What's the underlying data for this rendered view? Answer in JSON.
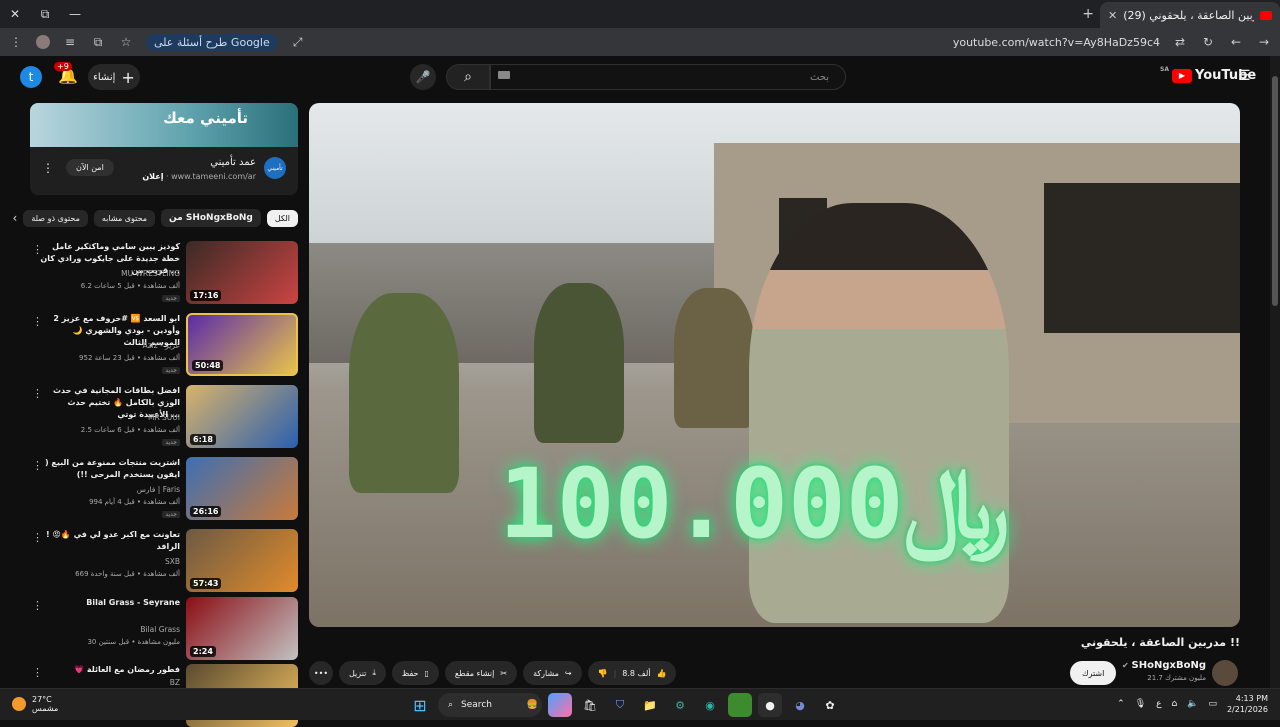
{
  "browser": {
    "tab_title": "(29) مدربين الصاعقة ، يلحقوني !!",
    "tab_close": "✕",
    "new_tab": "+",
    "window_controls": {
      "minimize": "—",
      "restore": "⧉",
      "close": "✕"
    },
    "google_chip": "طرح أسئلة على Google",
    "url": "youtube.com/watch?v=Ay8HaDz59c4"
  },
  "youtube": {
    "avatar_letter": "t",
    "notifications_count": "+9",
    "create_label": "إنشاء",
    "search_placeholder": "بحث",
    "logo_text": "YouTube",
    "logo_region": "SA"
  },
  "ad": {
    "banner_text": "تأميني معك",
    "logo_text": "تأميني",
    "title": "عمد تأميني",
    "sponsor_label": "إعلان",
    "domain": "www.tameeni.com/ar",
    "cta": "امن الآن"
  },
  "chips": [
    {
      "label": "الكل",
      "active": true
    },
    {
      "label": "من SHoNgxBoNg",
      "active": false
    },
    {
      "label": "محتوى مشابه",
      "active": false
    },
    {
      "label": "محتوى ذو صلة",
      "active": false
    }
  ],
  "recommendations": [
    {
      "title": "كوديز يبين سامي وماكثكير عامل خطة جديدة على جايكوب ورادي كان قريب من ...",
      "channel": "MU WRESTLING",
      "meta": "6.2 ألف مشاهدة • قبل 5 ساعات",
      "badge": "جديد",
      "duration": "17:16",
      "colors": [
        "#3a2a24",
        "#c44"
      ]
    },
    {
      "title": "حروف مع عزيز 2# 🆚 ابو السعد وأودين - بودي والشهري 🌙 الموسم الثالث",
      "channel": "Aziz - عزيز",
      "meta": "952 ألف مشاهدة • قبل 23 ساعة",
      "badge": "جديد",
      "duration": "50:48",
      "colors": [
        "#5b2aa8",
        "#e8c44b"
      ]
    },
    {
      "title": "افضل بطاقات المجانية في حدث الوزي بالكامل 🔥 تختيم حدث الأعمدة توتي ...",
      "channel": "MR SUUI",
      "meta": "2.5 ألف مشاهدة • قبل 6 ساعات",
      "badge": "جديد",
      "duration": "6:18",
      "colors": [
        "#d9b36b",
        "#2a5fb0"
      ]
    },
    {
      "title": "اشتريت منتجات ممنوعة من البيع ( ايفون يستخدم المرحى !!)",
      "channel": "فارس | Faris",
      "meta": "994 ألف مشاهدة • قبل 4 أيام",
      "badge": "جديد",
      "duration": "26:16",
      "colors": [
        "#3d6fb4",
        "#c97a3a"
      ]
    },
    {
      "title": "! 😡🔥 تعاونت مع اكبر عدو لي في الرافد",
      "channel": "SXB",
      "meta": "669 ألف مشاهدة • قبل سنة واحدة",
      "badge": "",
      "duration": "57:43",
      "colors": [
        "#6b5a44",
        "#e28b2b"
      ]
    },
    {
      "title": "Bilal Grass - Seyrane",
      "channel": "Bilal Grass",
      "meta": "30 مليون مشاهدة • قبل سنتين",
      "badge": "",
      "duration": "2:24",
      "colors": [
        "#8b0d14",
        "#c2c2c2"
      ]
    },
    {
      "title": "💗 فطور رمضان مع العائلة",
      "channel": "BZ",
      "meta": "",
      "badge": "",
      "duration": "",
      "colors": [
        "#5a4a30",
        "#f0c060"
      ]
    }
  ],
  "video": {
    "overlay_text": "100.000",
    "currency": "﷼",
    "title": "مدربين الصاعقة ، يلحقوني !!",
    "channel": "SHoNgxBoNg",
    "subscribers": "21.7 مليون مشترك",
    "subscribe_label": "اشترك"
  },
  "actions": {
    "like_count": "8.8 ألف",
    "share": "مشاركة",
    "clip": "إنشاء مقطع",
    "save": "حفظ",
    "download": "تنزيل",
    "more": "•••"
  },
  "taskbar": {
    "temp": "27°C",
    "condition": "مشمس",
    "search": "Search",
    "lang": "ع",
    "time": "4:13 PM",
    "date": "2/21/2026"
  }
}
